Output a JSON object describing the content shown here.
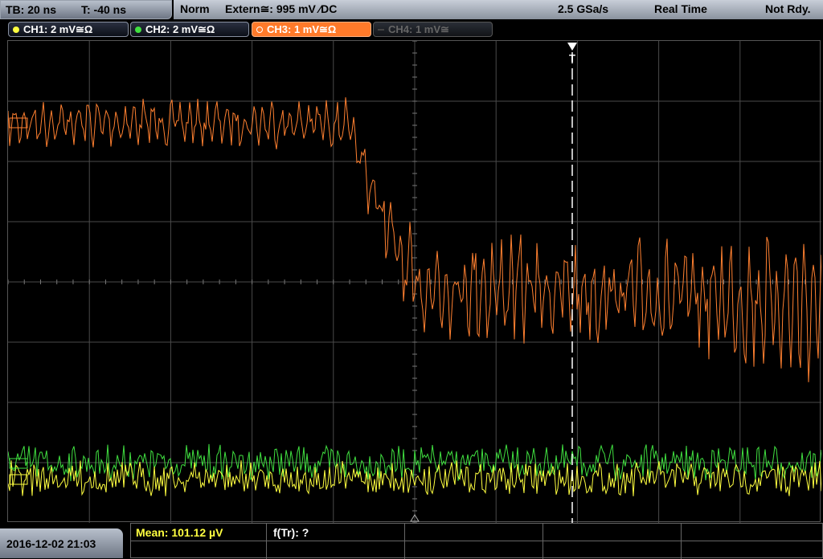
{
  "topbar": {
    "timebase": "TB: 20 ns",
    "trigger_time": "T: -40 ns",
    "acq_mode": "Norm",
    "trigger_source": "Extern≅: 995 mV ⁄DC",
    "sample_rate": "2.5 GSa/s",
    "mode": "Real Time",
    "status": "Not Rdy."
  },
  "channels": [
    {
      "label": "CH1: 2 mV≅Ω",
      "color": "#ffff40",
      "active": true
    },
    {
      "label": "CH2: 2 mV≅Ω",
      "color": "#40e040",
      "active": true
    },
    {
      "label": "CH3: 1 mV≅Ω",
      "color": "#ff8030",
      "active": true,
      "selected": true
    },
    {
      "label": "CH4: 1 mV≅",
      "color": "#666666",
      "active": false
    }
  ],
  "trigger_marker": "T",
  "bottom": {
    "datetime": "2016-12-02 21:03",
    "measurement_1": "Mean: 101.12 µV",
    "measurement_2": "f(Tr): ?"
  },
  "colors": {
    "ch1": "#ffff40",
    "ch2": "#40e040",
    "ch3": "#ff8030",
    "grid": "#4a4a4a"
  }
}
